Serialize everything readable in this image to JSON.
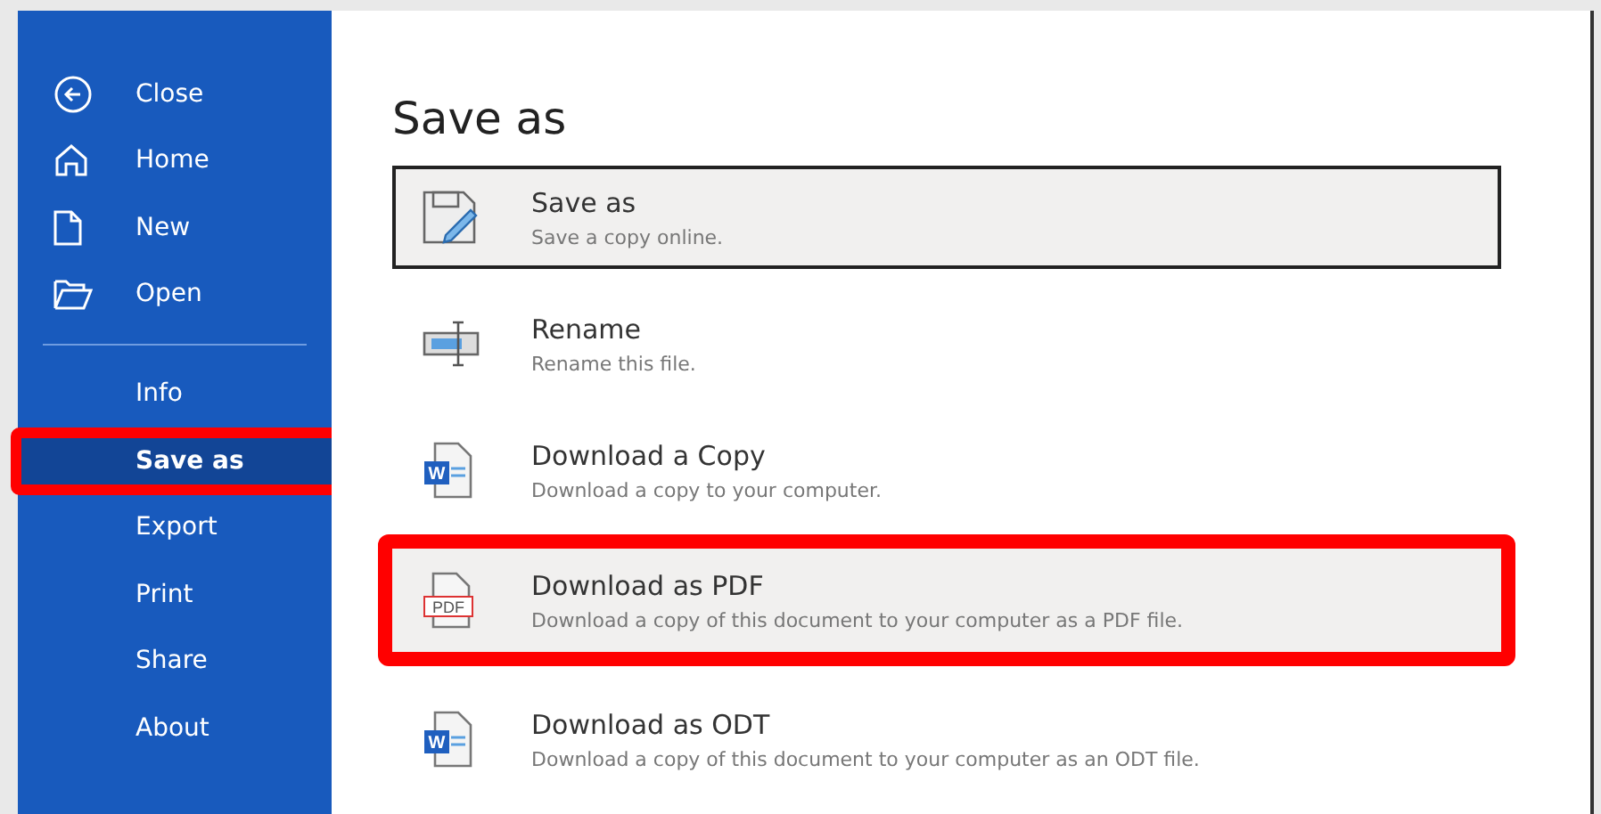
{
  "sidebar": {
    "items": [
      {
        "label": "Close",
        "kind": "back",
        "selected": false,
        "highlighted": false
      },
      {
        "label": "Home",
        "kind": "home",
        "selected": false,
        "highlighted": false
      },
      {
        "label": "New",
        "kind": "file",
        "selected": false,
        "highlighted": false
      },
      {
        "label": "Open",
        "kind": "folder",
        "selected": false,
        "highlighted": false
      },
      {
        "label": "Info",
        "kind": "text",
        "selected": false,
        "highlighted": false
      },
      {
        "label": "Save as",
        "kind": "text",
        "selected": true,
        "highlighted": true
      },
      {
        "label": "Export",
        "kind": "text",
        "selected": false,
        "highlighted": false
      },
      {
        "label": "Print",
        "kind": "text",
        "selected": false,
        "highlighted": false
      },
      {
        "label": "Share",
        "kind": "text",
        "selected": false,
        "highlighted": false
      },
      {
        "label": "About",
        "kind": "text",
        "selected": false,
        "highlighted": false
      }
    ]
  },
  "main": {
    "title": "Save as",
    "options": [
      {
        "kind": "save",
        "title": "Save as",
        "description": "Save a copy online.",
        "selected": true,
        "highlighted": false
      },
      {
        "kind": "rename",
        "title": "Rename",
        "description": "Rename this file.",
        "selected": false,
        "highlighted": false
      },
      {
        "kind": "word",
        "badge": "W",
        "title": "Download a Copy",
        "description": "Download a copy to your computer.",
        "selected": false,
        "highlighted": false
      },
      {
        "kind": "pdf",
        "badge": "PDF",
        "title": "Download as PDF",
        "description": "Download a copy of this document to your computer as a PDF file.",
        "selected": false,
        "highlighted": true
      },
      {
        "kind": "word",
        "badge": "W",
        "title": "Download as ODT",
        "description": "Download a copy of this document to your computer as an ODT file.",
        "selected": false,
        "highlighted": false
      }
    ]
  }
}
